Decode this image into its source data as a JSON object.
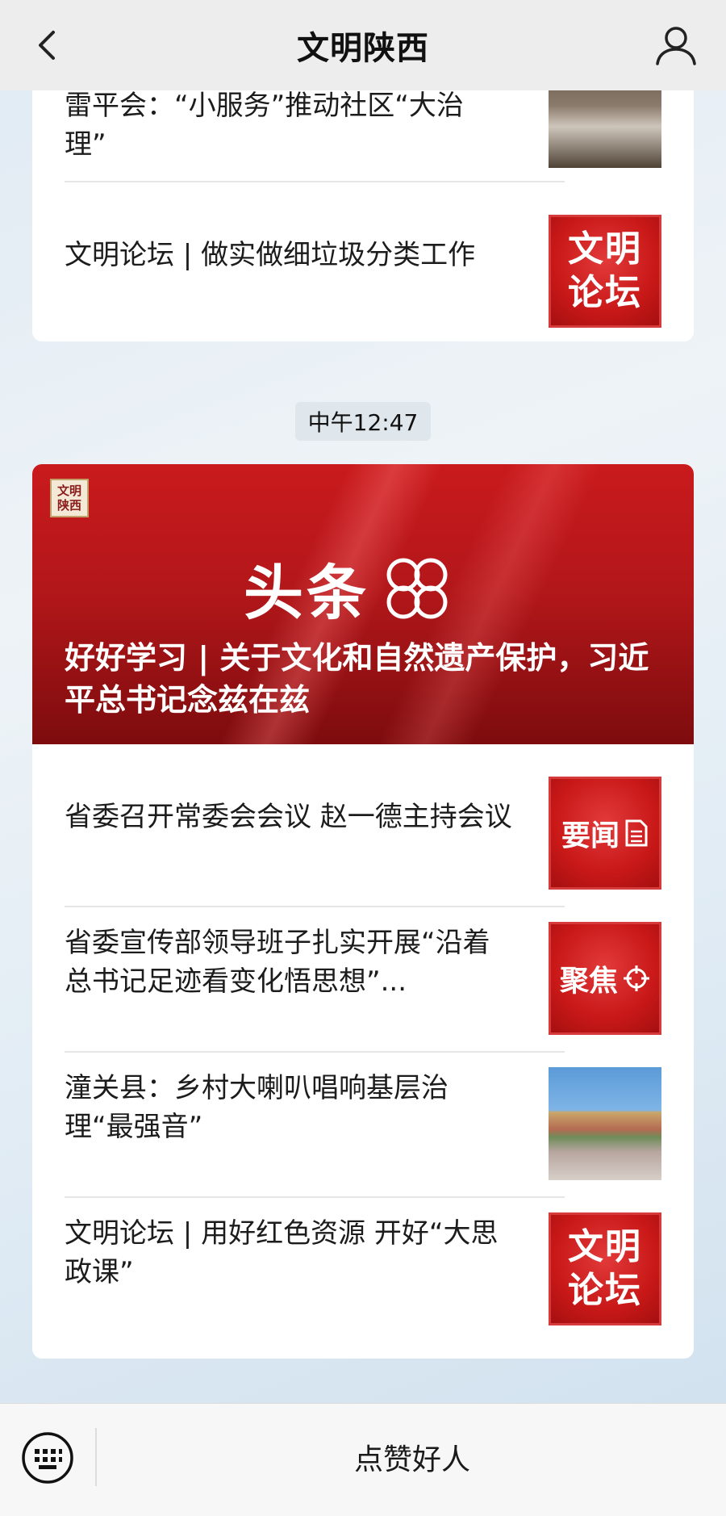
{
  "header": {
    "title": "文明陕西",
    "back_icon": "chevron-left-icon",
    "profile_icon": "person-icon"
  },
  "card1": {
    "items": [
      {
        "text": "雷平会：“小服务”推动社区“大治理”",
        "thumb": "photo"
      },
      {
        "text": "文明论坛 | 做实做细垃圾分类工作",
        "thumb": "文明论坛"
      }
    ]
  },
  "time_chip": "中午12:47",
  "card2": {
    "banner": {
      "logo_text": "文明陕西",
      "mark_text": "头条",
      "caption": "好好学习 | 关于文化和自然遗产保护，习近平总书记念兹在兹"
    },
    "items": [
      {
        "text": "省委召开常委会会议 赵一德主持会议",
        "thumb_label": "要闻"
      },
      {
        "text": "省委宣传部领导班子扎实开展“沿着总书记足迹看变化悟思想”...",
        "thumb_label": "聚焦"
      },
      {
        "text": "潼关县：乡村大喇叭唱响基层治理“最强音”",
        "thumb_label": ""
      },
      {
        "text": "文明论坛 | 用好红色资源 开好“大思政课”",
        "thumb_label": "文明论坛"
      }
    ],
    "thumb_text": {
      "wenming_line1": "文明",
      "wenming_line2": "论坛"
    }
  },
  "bottom_bar": {
    "keyboard_icon": "keyboard-icon",
    "menu_label": "点赞好人"
  },
  "colors": {
    "accent_red": "#c91818",
    "header_bg": "#ededed",
    "card_bg": "#ffffff"
  }
}
